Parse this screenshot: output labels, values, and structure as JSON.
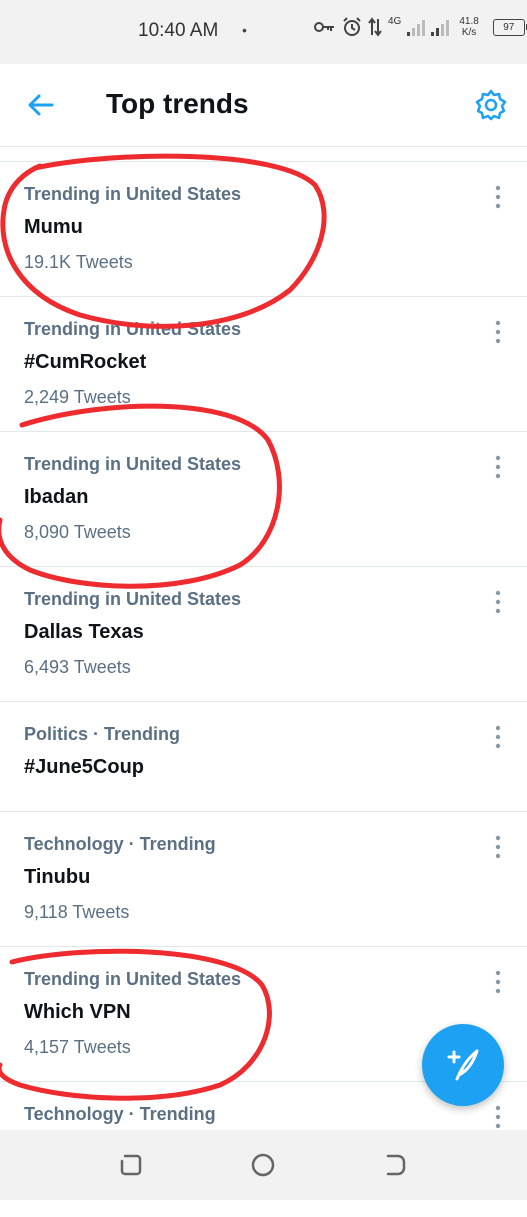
{
  "status_bar": {
    "time": "10:40 AM",
    "dot": "•",
    "network": "4G",
    "speed_value": "41.8",
    "speed_unit": "K/s",
    "battery": "97"
  },
  "header": {
    "title": "Top trends",
    "back_icon": "back-arrow-icon",
    "settings_icon": "gear-icon",
    "accent_color": "#1da1f2"
  },
  "trends": [
    {
      "meta": "Trending in United States",
      "name": "Mumu",
      "count": "19.1K Tweets"
    },
    {
      "meta": "Trending in United States",
      "name": "#CumRocket",
      "count": "2,249 Tweets"
    },
    {
      "meta": "Trending in United States",
      "name": "Ibadan",
      "count": "8,090 Tweets"
    },
    {
      "meta": "Trending in United States",
      "name": "Dallas Texas",
      "count": "6,493 Tweets"
    },
    {
      "meta": "Politics · Trending",
      "name": "#June5Coup",
      "count": ""
    },
    {
      "meta": "Technology · Trending",
      "name": "Tinubu",
      "count": "9,118 Tweets"
    },
    {
      "meta": "Trending in United States",
      "name": "Which VPN",
      "count": "4,157 Tweets"
    },
    {
      "meta": "Technology · Trending",
      "name": "",
      "count": ""
    }
  ],
  "fab": {
    "icon": "compose-tweet-icon",
    "color": "#1da1f2"
  },
  "annotation_color": "#ee2b2f",
  "nav_bar": {
    "icons": [
      "recent-apps-icon",
      "home-icon",
      "back-icon"
    ]
  }
}
